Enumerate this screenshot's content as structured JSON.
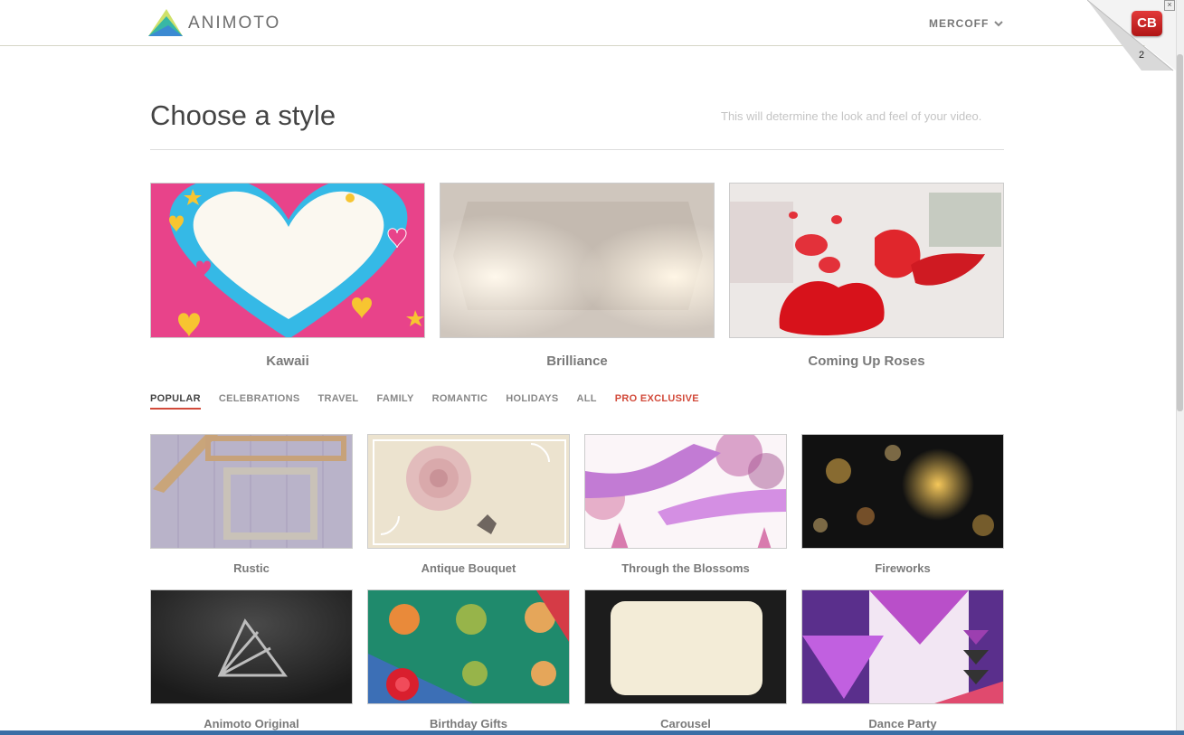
{
  "header": {
    "brand": "ANIMOTO",
    "user_menu": "MERCOFF"
  },
  "corner_badge": {
    "label": "CB",
    "count": "2",
    "close": "×"
  },
  "page": {
    "title": "Choose a style",
    "subtitle": "This will determine the look and feel of your video."
  },
  "featured": [
    {
      "name": "Kawaii"
    },
    {
      "name": "Brilliance"
    },
    {
      "name": "Coming Up Roses"
    }
  ],
  "tabs": [
    {
      "label": "POPULAR",
      "active": true
    },
    {
      "label": "CELEBRATIONS"
    },
    {
      "label": "TRAVEL"
    },
    {
      "label": "FAMILY"
    },
    {
      "label": "ROMANTIC"
    },
    {
      "label": "HOLIDAYS"
    },
    {
      "label": "ALL"
    },
    {
      "label": "PRO EXCLUSIVE",
      "highlight": true
    }
  ],
  "styles": [
    {
      "name": "Rustic"
    },
    {
      "name": "Antique Bouquet"
    },
    {
      "name": "Through the Blossoms"
    },
    {
      "name": "Fireworks"
    },
    {
      "name": "Animoto Original"
    },
    {
      "name": "Birthday Gifts"
    },
    {
      "name": "Carousel"
    },
    {
      "name": "Dance Party"
    }
  ],
  "colors": {
    "accent": "#d24a3a",
    "rule": "#dddddd",
    "text": "#7a7a7a"
  }
}
